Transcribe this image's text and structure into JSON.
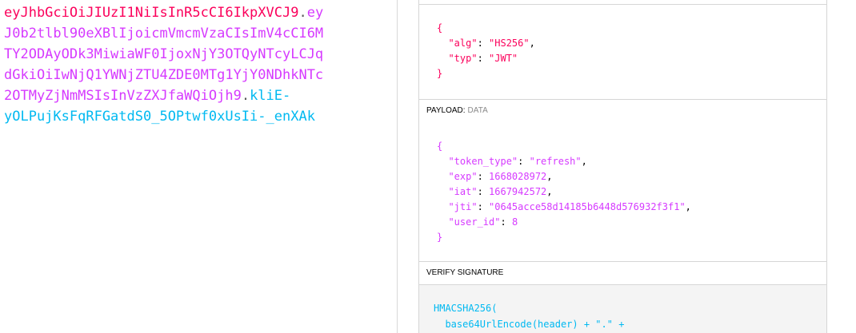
{
  "encoded_token": {
    "lines": [
      [
        {
          "t": "eyJhbGciOiJIUzI1NiIsInR5cCI6IkpXVCJ9",
          "c": "header"
        },
        {
          "t": ".",
          "c": "dot"
        },
        {
          "t": "ey",
          "c": "payload"
        }
      ],
      [
        {
          "t": "J0b2tlbl90eXBlIjoicmVmcmVzaCIsImV4cCI6M",
          "c": "payload"
        }
      ],
      [
        {
          "t": "TY2ODAyODk3MiwiaWF0IjoxNjY3OTQyNTcyLCJq",
          "c": "payload"
        }
      ],
      [
        {
          "t": "dGkiOiIwNjQ1YWNjZTU4ZDE0MTg1YjY0NDhkNTc",
          "c": "payload"
        }
      ],
      [
        {
          "t": "2OTMyZjNmMSIsInVzZXJfaWQiOjh9",
          "c": "payload"
        },
        {
          "t": ".",
          "c": "dot"
        },
        {
          "t": "kliE-",
          "c": "sig"
        }
      ],
      [
        {
          "t": "yOLPujKsFqRFGatdS0_5OPtwf0xUsIi-_enXAk",
          "c": "sig"
        }
      ]
    ]
  },
  "header_panel": {
    "open": "{",
    "close": "}",
    "fields": [
      {
        "key": "\"alg\"",
        "value": "\"HS256\"",
        "sep": ","
      },
      {
        "key": "\"typ\"",
        "value": "\"JWT\"",
        "sep": ""
      }
    ]
  },
  "payload_panel": {
    "title": "PAYLOAD:",
    "subtitle": "DATA",
    "open": "{",
    "close": "}",
    "fields": [
      {
        "key": "\"token_type\"",
        "value": "\"refresh\"",
        "sep": ","
      },
      {
        "key": "\"exp\"",
        "value": "1668028972",
        "sep": ","
      },
      {
        "key": "\"iat\"",
        "value": "1667942572",
        "sep": ","
      },
      {
        "key": "\"jti\"",
        "value": "\"0645acce58d14185b6448d576932f3f1\"",
        "sep": ","
      },
      {
        "key": "\"user_id\"",
        "value": "8",
        "sep": ""
      }
    ]
  },
  "verify_panel": {
    "title": "VERIFY SIGNATURE",
    "lines": [
      "HMACSHA256(",
      "  base64UrlEncode(header) + \".\" +"
    ]
  },
  "colors": {
    "header": "#fb015b",
    "payload": "#d63aff",
    "signature": "#00b9f1"
  }
}
